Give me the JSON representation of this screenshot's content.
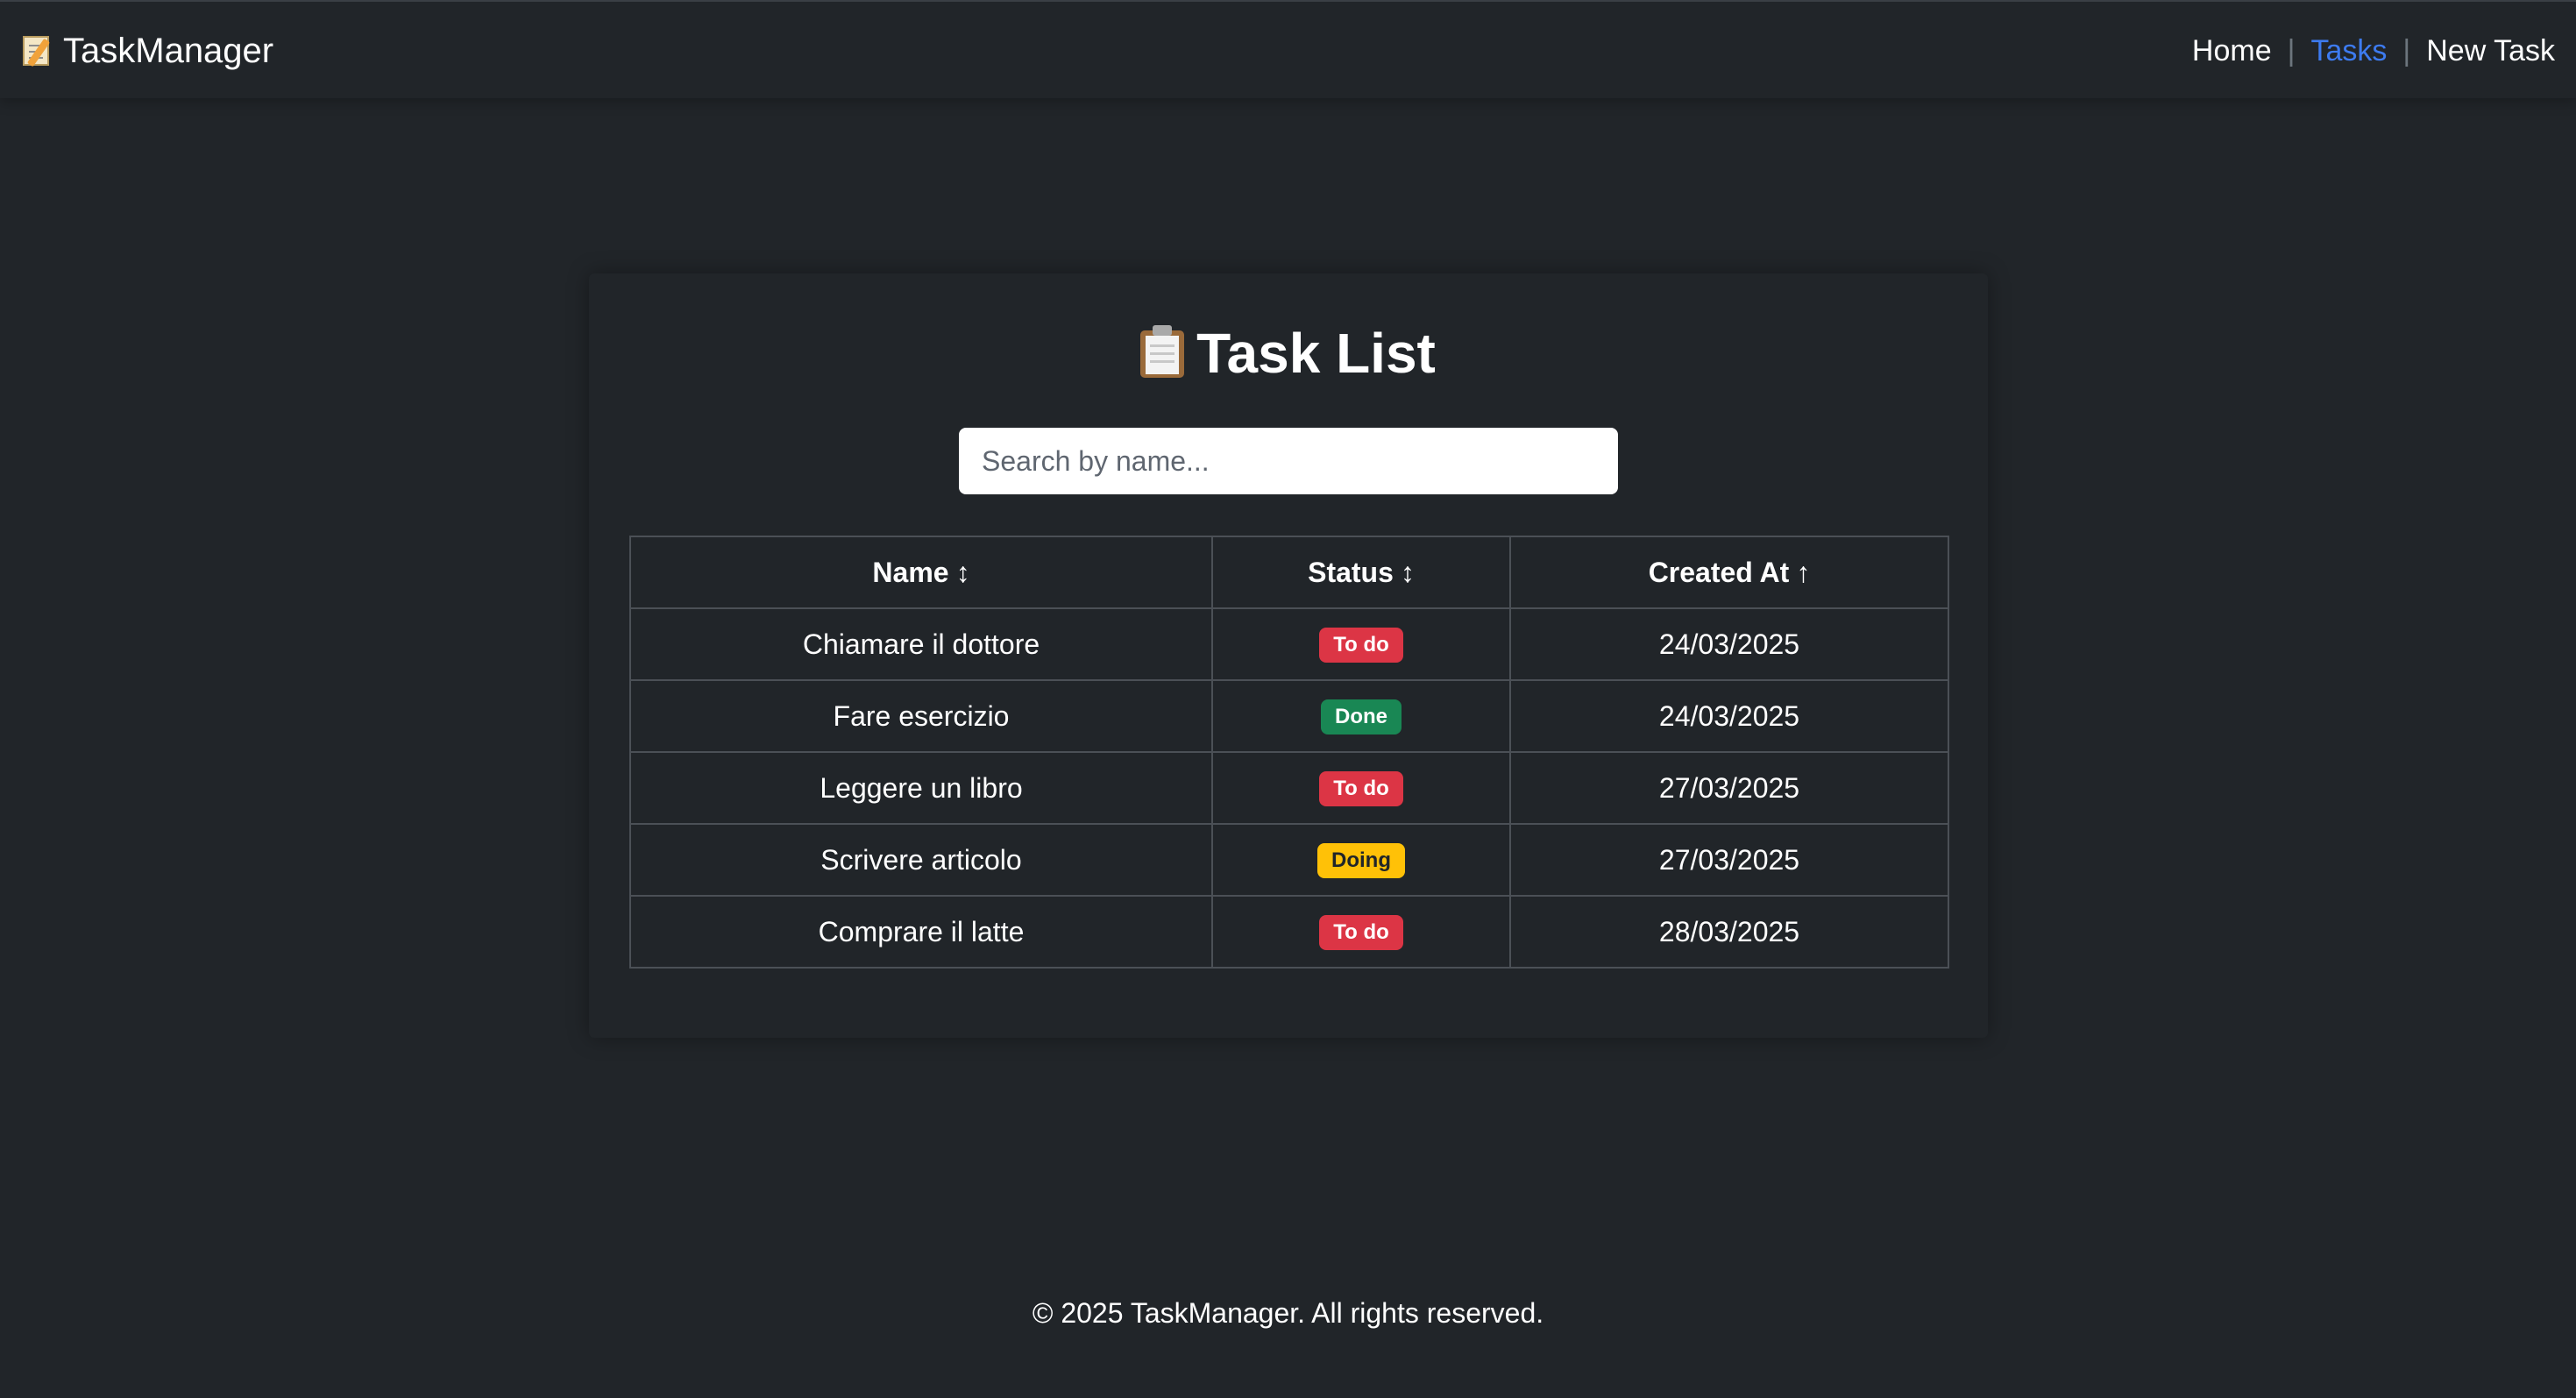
{
  "navbar": {
    "brand_icon": "memo-icon",
    "brand": "TaskManager",
    "links": {
      "home": "Home",
      "tasks": "Tasks",
      "new_task": "New Task"
    },
    "separator": "|",
    "active_link": "Tasks",
    "active_color": "#3d7bf0"
  },
  "main": {
    "title_icon": "clipboard-icon",
    "title": "Task List",
    "search": {
      "placeholder": "Search by name...",
      "value": ""
    },
    "table": {
      "columns": [
        {
          "label": "Name",
          "sort_icon": "↕"
        },
        {
          "label": "Status",
          "sort_icon": "↕"
        },
        {
          "label": "Created At",
          "sort_icon": "↑"
        }
      ],
      "rows": [
        {
          "name": "Chiamare il dottore",
          "status": "To do",
          "created_at": "24/03/2025"
        },
        {
          "name": "Fare esercizio",
          "status": "Done",
          "created_at": "24/03/2025"
        },
        {
          "name": "Leggere un libro",
          "status": "To do",
          "created_at": "27/03/2025"
        },
        {
          "name": "Scrivere articolo",
          "status": "Doing",
          "created_at": "27/03/2025"
        },
        {
          "name": "Comprare il latte",
          "status": "To do",
          "created_at": "28/03/2025"
        }
      ]
    },
    "status_colors": {
      "todo": "#dc3545",
      "done": "#198754",
      "doing": "#ffc107"
    }
  },
  "footer": {
    "text": "© 2025 TaskManager. All rights reserved."
  }
}
